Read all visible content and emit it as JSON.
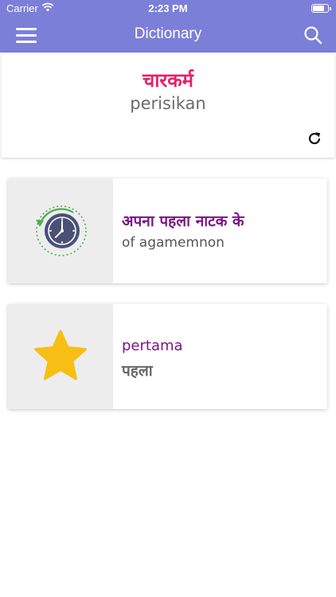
{
  "status_bar": {
    "carrier": "Carrier",
    "time": "2:23 PM",
    "wifi_icon": "wifi-icon",
    "battery_icon": "battery-icon"
  },
  "navbar": {
    "title": "Dictionary",
    "menu_icon": "hamburger-menu-icon",
    "search_icon": "search-icon",
    "background_color": "#7b7fd8"
  },
  "word_of_day": {
    "hindi": "चारकर्म",
    "transliteration": "perisikan",
    "refresh_icon": "refresh-icon",
    "hindi_color": "#e2226b"
  },
  "history_card": {
    "icon": "history-clock-icon",
    "line1": "अपना पहला नाटक के",
    "line2": "of agamemnon",
    "accent_color": "#7a1784"
  },
  "favorites_card": {
    "icon": "star-icon",
    "line1": "pertama",
    "line2": "पहला",
    "star_color": "#f7be16"
  }
}
